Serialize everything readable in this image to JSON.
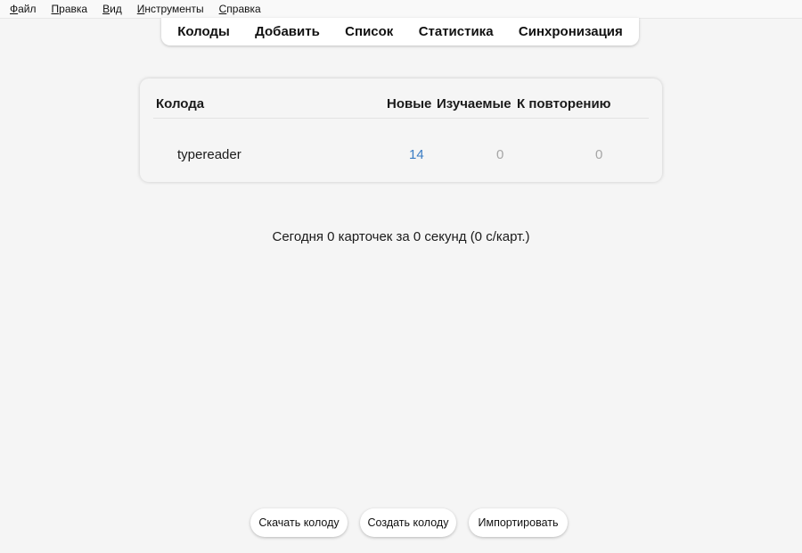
{
  "menubar": {
    "items": [
      {
        "first": "Ф",
        "rest": "айл"
      },
      {
        "first": "П",
        "rest": "равка"
      },
      {
        "first": "В",
        "rest": "ид"
      },
      {
        "first": "И",
        "rest": "нструменты"
      },
      {
        "first": "С",
        "rest": "правка"
      }
    ]
  },
  "toolbar": {
    "decks": "Колоды",
    "add": "Добавить",
    "browse": "Список",
    "stats": "Статистика",
    "sync": "Синхронизация"
  },
  "deck_table": {
    "headers": {
      "deck": "Колода",
      "new": "Новые",
      "learning": "Изучаемые",
      "due": "К повторению"
    },
    "rows": [
      {
        "name": "typereader",
        "new": "14",
        "learning": "0",
        "due": "0"
      }
    ]
  },
  "today_stats": "Сегодня 0 карточек за 0 секунд (0 с/карт.)",
  "bottom_buttons": {
    "download": "Скачать колоду",
    "create": "Создать колоду",
    "import": "Импортировать"
  },
  "colors": {
    "new_count": "#3b7dc4",
    "zero_count": "#a6a6a6",
    "background": "#f5f5f5"
  }
}
